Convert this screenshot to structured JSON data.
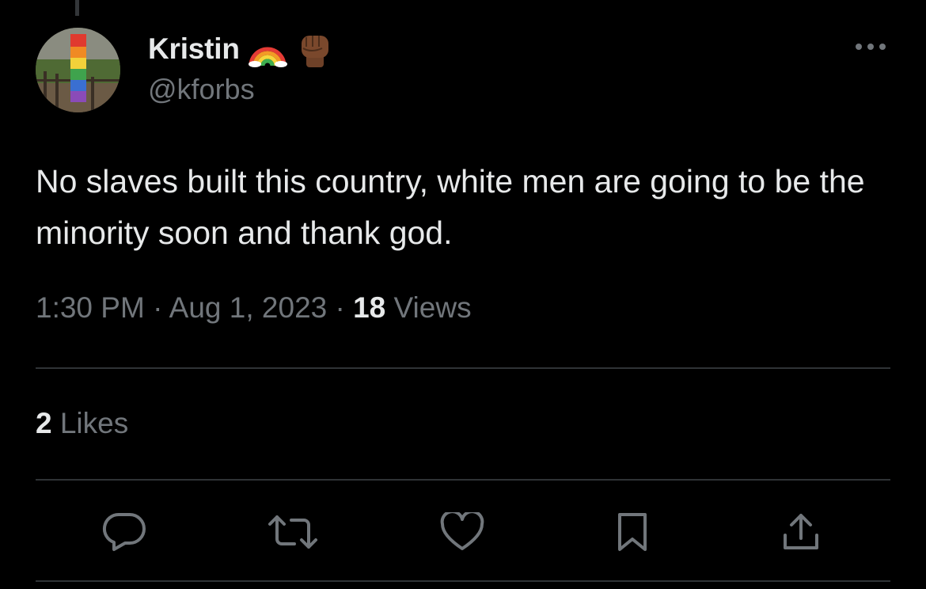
{
  "author": {
    "display_name": "Kristin",
    "handle": "@kforbs",
    "name_emojis": [
      "rainbow-emoji",
      "raised-fist-emoji"
    ]
  },
  "tweet": {
    "text": "No slaves built this country, white men are going to be the minority soon and thank god.",
    "time": "1:30 PM",
    "separator": "·",
    "date": "Aug 1, 2023",
    "views_count": "18",
    "views_label": "Views"
  },
  "engagement": {
    "likes_count": "2",
    "likes_label": "Likes"
  },
  "actions": [
    {
      "name": "reply",
      "icon": "reply-icon"
    },
    {
      "name": "retweet",
      "icon": "retweet-icon"
    },
    {
      "name": "like",
      "icon": "heart-icon"
    },
    {
      "name": "bookmark",
      "icon": "bookmark-icon"
    },
    {
      "name": "share",
      "icon": "share-icon"
    }
  ],
  "colors": {
    "background": "#000000",
    "primary_text": "#e7e9ea",
    "secondary_text": "#71767b",
    "divider": "#2f3336"
  }
}
